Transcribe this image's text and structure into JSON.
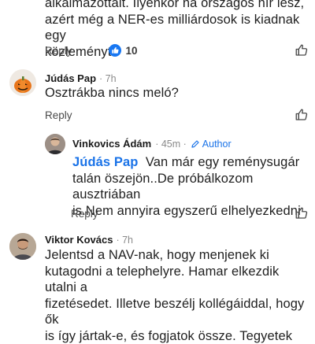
{
  "comment1": {
    "text_lines": [
      "alkalmazottait. Ilyenkor na országos hír lesz,",
      "azért még a NER-es milliárdosok is kiadnak egy",
      "közleményt."
    ],
    "reply_label": "Reply",
    "like_count": "10"
  },
  "comment2": {
    "author": "Júdás Pap",
    "time": "· 7h",
    "text": "Osztrákba nincs meló?",
    "reply_label": "Reply"
  },
  "reply1": {
    "author": "Vinkovics Ádám",
    "time": "· 45m ·",
    "badge": "Author",
    "mention": "Júdás Pap",
    "text_lines": [
      "Van már egy reménysugár",
      "talán öszejön..De próbálkozom ausztriában",
      "is.Nem annyira egyszerű elhelyezkedni"
    ],
    "reply_label": "Reply"
  },
  "comment3": {
    "author": "Viktor Kovács",
    "time": "· 7h",
    "text_lines": [
      "Jelentsd a NAV-nak, hogy menjenek ki",
      "kutagodni a telephelyre. Hamar elkezdik utalni a",
      "fizetésedet. Illetve beszélj kollégáiddal, hogy ők",
      "is így jártak-e, és fogjatok össze. Tegyetek"
    ]
  },
  "colors": {
    "link_blue": "#1a73e8",
    "like_blue": "#1877f2"
  }
}
